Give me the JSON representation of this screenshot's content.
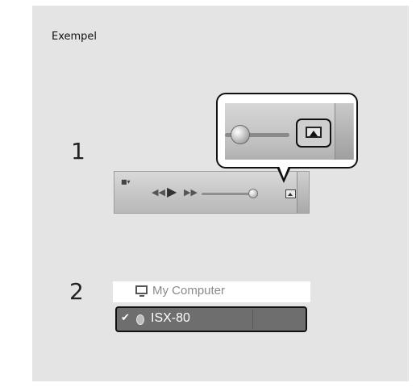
{
  "heading": "Exempel",
  "steps": [
    {
      "number": "1"
    },
    {
      "number": "2"
    }
  ],
  "toolbar": {
    "buttons": [
      "rewind-icon",
      "play-icon",
      "fast-forward-icon",
      "volume-slider",
      "airplay-icon"
    ],
    "glyphs": {
      "prev": "◀◀",
      "play": "▶",
      "next": "▶▶",
      "menu": "■▾"
    }
  },
  "device_list": {
    "items": [
      {
        "label": "My Computer",
        "icon": "monitor-icon",
        "selected": false
      },
      {
        "label": "ISX-80",
        "icon": "speaker-icon",
        "selected": true,
        "check": "✔"
      }
    ]
  },
  "colors": {
    "panel": "#e4e4e4",
    "highlight_border": "#111111",
    "selected_row": "#6e6e6e"
  }
}
